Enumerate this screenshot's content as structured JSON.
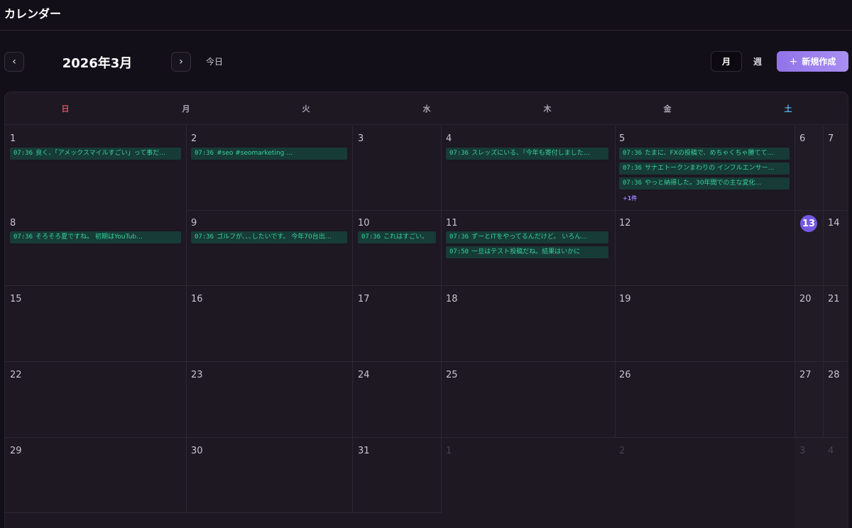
{
  "page_title": "カレンダー",
  "nav": {
    "prev_label": "‹",
    "next_label": "›",
    "month_label": "2026年3月",
    "today_label": "今日"
  },
  "views": [
    {
      "label": "月",
      "active": true
    },
    {
      "label": "週",
      "active": false
    }
  ],
  "new_button": {
    "icon": "+",
    "label": "新規作成"
  },
  "colors": {
    "sunday": "#e0505e",
    "saturday": "#5aaeea",
    "accent": "#7558e2",
    "event_bg": "#173b37",
    "event_text": "#37d39b"
  },
  "weekdays": [
    "日",
    "月",
    "火",
    "水",
    "木",
    "金",
    "土"
  ],
  "weeks": [
    [
      "1",
      "2",
      "3",
      "4",
      "5",
      "6",
      "7"
    ],
    [
      "8",
      "9",
      "10",
      "11",
      "12",
      "13",
      "14"
    ],
    [
      "15",
      "16",
      "17",
      "18",
      "19",
      "20",
      "21"
    ],
    [
      "22",
      "23",
      "24",
      "25",
      "26",
      "27",
      "28"
    ],
    [
      "29",
      "30",
      "31",
      "1",
      "2",
      "3",
      "4"
    ]
  ],
  "today": "13",
  "events": [
    {
      "time": "07:36",
      "title": "良く、「アメックスマイルすごい」って事だ…"
    },
    {
      "time": "07:36",
      "title": "#seo #seomarketing …"
    },
    {
      "time": "07:36",
      "title": "スレッズにいる、『今年も寄付しました…"
    },
    {
      "time": "07:36",
      "title": "たまに、FXの投稿で、めちゃくちゃ勝てて…"
    },
    {
      "time": "07:36",
      "title": "サナエトークンまわりの インフルエンサー…"
    },
    {
      "time": "07:36",
      "title": "やっと納得した。30年間での主な変化…"
    },
    {
      "time": "07:36",
      "title": "そろそろ夏ですね。 初期はYouTub…"
    },
    {
      "time": "07:36",
      "title": "ゴルフが､､､したいです。 今年70台出…"
    },
    {
      "time": "07:36",
      "title": "これはすごい。"
    },
    {
      "time": "07:36",
      "title": "ずーとITをやってるんだけど。 いろん…"
    },
    {
      "time": "07:50",
      "title": "一旦はテスト投稿だね。結果はいかに"
    }
  ],
  "more_label": "+1件"
}
